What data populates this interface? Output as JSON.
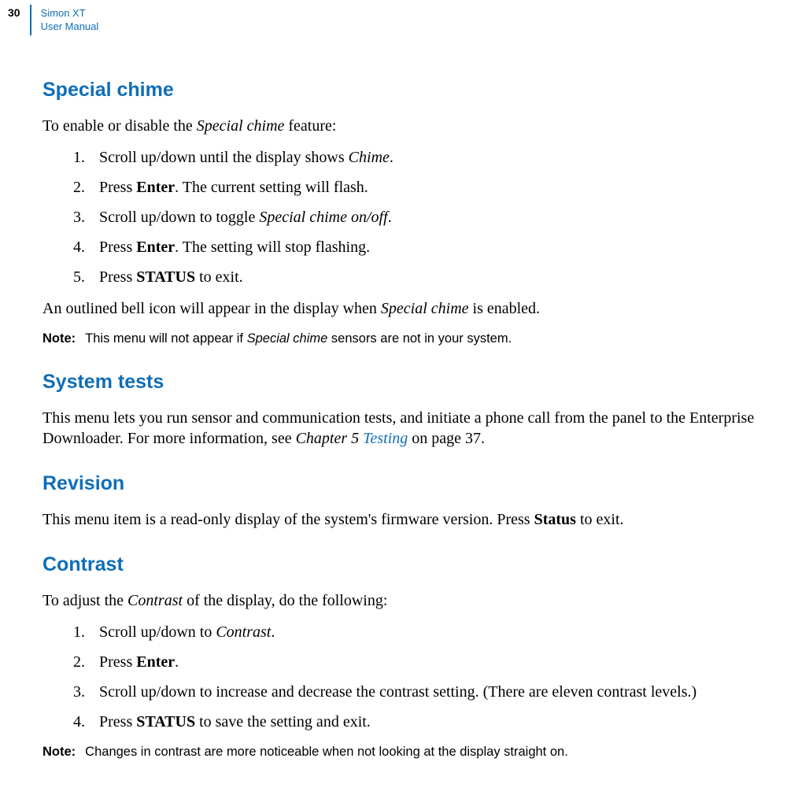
{
  "header": {
    "page_number": "30",
    "title_line1": "Simon XT",
    "title_line2": "User Manual"
  },
  "sections": {
    "special_chime": {
      "heading": "Special chime",
      "intro_pre": "To enable or disable the ",
      "intro_em": "Special chime",
      "intro_post": " feature:",
      "steps": [
        {
          "n": "1.",
          "pre": "Scroll up/down until the display shows ",
          "em": "Chime",
          "post": "."
        },
        {
          "n": "2.",
          "pre": "Press ",
          "b": "Enter",
          "post": ". The current setting will flash."
        },
        {
          "n": "3.",
          "pre": "Scroll up/down to toggle ",
          "em": "Special chime on/off",
          "post": "."
        },
        {
          "n": "4.",
          "pre": "Press ",
          "b": "Enter",
          "post": ". The setting will stop flashing."
        },
        {
          "n": "5.",
          "pre": "Press ",
          "b": "STATUS",
          "post": " to exit."
        }
      ],
      "tail_pre": "An outlined bell icon will appear in the display when ",
      "tail_em": "Special chime",
      "tail_post": " is enabled.",
      "note_label": "Note:",
      "note_pre": "This menu will not appear if ",
      "note_em": "Special chime",
      "note_post": " sensors are not in your system."
    },
    "system_tests": {
      "heading": "System tests",
      "body_pre": "This menu lets you run sensor and communication tests, and initiate a phone call from the panel to the Enterprise Downloader. For more information, see ",
      "body_em": "Chapter 5 ",
      "body_link": "Testing",
      "body_post": " on page 37."
    },
    "revision": {
      "heading": "Revision",
      "body_pre": "This menu item is a read-only display of the system's firmware version.  Press ",
      "body_b": "Status",
      "body_post": " to exit."
    },
    "contrast": {
      "heading": "Contrast",
      "intro_pre": "To adjust the ",
      "intro_em": "Contrast",
      "intro_post": " of the display, do the following:",
      "steps": [
        {
          "n": "1.",
          "pre": "Scroll up/down to ",
          "em": "Contrast",
          "post": "."
        },
        {
          "n": "2.",
          "pre": "Press ",
          "b": "Enter",
          "post": "."
        },
        {
          "n": "3.",
          "pre": "Scroll up/down to increase and decrease the contrast setting. (There are eleven contrast levels.)"
        },
        {
          "n": "4.",
          "pre": "Press ",
          "b": "STATUS",
          "post": " to save the setting and exit."
        }
      ],
      "note_label": "Note:",
      "note_body": "Changes in contrast are more noticeable when not looking at the display straight on."
    }
  }
}
